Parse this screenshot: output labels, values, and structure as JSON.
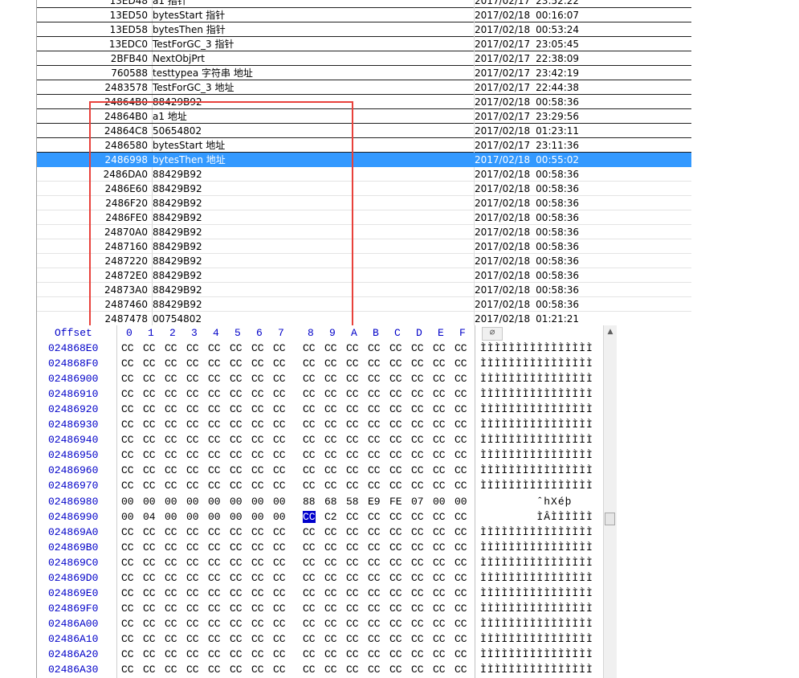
{
  "list": {
    "rows": [
      {
        "addr": "13ED48",
        "name": "a1 指针",
        "date": "2017/02/17",
        "time": "23:52:22"
      },
      {
        "addr": "13ED50",
        "name": "bytesStart 指针",
        "date": "2017/02/18",
        "time": "00:16:07"
      },
      {
        "addr": "13ED58",
        "name": "bytesThen 指针",
        "date": "2017/02/18",
        "time": "00:53:24"
      },
      {
        "addr": "13EDC0",
        "name": "TestForGC_3  指针",
        "date": "2017/02/17",
        "time": "23:05:45"
      },
      {
        "addr": "2BFB40",
        "name": "NextObjPrt",
        "date": "2017/02/17",
        "time": "22:38:09"
      },
      {
        "addr": "760588",
        "name": "testtypea 字符串 地址",
        "date": "2017/02/17",
        "time": "23:42:19"
      },
      {
        "addr": "2483578",
        "name": "TestForGC_3 地址",
        "date": "2017/02/17",
        "time": "22:44:38"
      },
      {
        "addr": "24864B0",
        "name": "88429B92",
        "date": "2017/02/18",
        "time": "00:58:36"
      },
      {
        "addr": "24864B0",
        "name": "a1 地址",
        "date": "2017/02/17",
        "time": "23:29:56"
      },
      {
        "addr": "24864C8",
        "name": "50654802",
        "date": "2017/02/18",
        "time": "01:23:11"
      },
      {
        "addr": "2486580",
        "name": "bytesStart 地址",
        "date": "2017/02/17",
        "time": "23:11:36"
      },
      {
        "addr": "2486998",
        "name": "bytesThen 地址",
        "date": "2017/02/18",
        "time": "00:55:02",
        "selected": true
      },
      {
        "addr": "2486DA0",
        "name": "88429B92",
        "date": "2017/02/18",
        "time": "00:58:36"
      },
      {
        "addr": "2486E60",
        "name": "88429B92",
        "date": "2017/02/18",
        "time": "00:58:36"
      },
      {
        "addr": "2486F20",
        "name": "88429B92",
        "date": "2017/02/18",
        "time": "00:58:36"
      },
      {
        "addr": "2486FE0",
        "name": "88429B92",
        "date": "2017/02/18",
        "time": "00:58:36"
      },
      {
        "addr": "24870A0",
        "name": "88429B92",
        "date": "2017/02/18",
        "time": "00:58:36"
      },
      {
        "addr": "2487160",
        "name": "88429B92",
        "date": "2017/02/18",
        "time": "00:58:36"
      },
      {
        "addr": "2487220",
        "name": "88429B92",
        "date": "2017/02/18",
        "time": "00:58:36"
      },
      {
        "addr": "24872E0",
        "name": "88429B92",
        "date": "2017/02/18",
        "time": "00:58:36"
      },
      {
        "addr": "24873A0",
        "name": "88429B92",
        "date": "2017/02/18",
        "time": "00:58:36"
      },
      {
        "addr": "2487460",
        "name": "88429B92",
        "date": "2017/02/18",
        "time": "00:58:36"
      },
      {
        "addr": "2487478",
        "name": "00754802",
        "date": "2017/02/18",
        "time": "01:21:21"
      }
    ]
  },
  "hex": {
    "header_label": "Offset",
    "columns": [
      "0",
      "1",
      "2",
      "3",
      "4",
      "5",
      "6",
      "7",
      "8",
      "9",
      "A",
      "B",
      "C",
      "D",
      "E",
      "F"
    ],
    "attach_icon": "paperclip-icon",
    "rows": [
      {
        "offset": "024868E0",
        "bytes": [
          "CC",
          "CC",
          "CC",
          "CC",
          "CC",
          "CC",
          "CC",
          "CC",
          "CC",
          "CC",
          "CC",
          "CC",
          "CC",
          "CC",
          "CC",
          "CC"
        ],
        "ascii": "ÌÌÌÌÌÌÌÌÌÌÌÌÌÌÌÌ"
      },
      {
        "offset": "024868F0",
        "bytes": [
          "CC",
          "CC",
          "CC",
          "CC",
          "CC",
          "CC",
          "CC",
          "CC",
          "CC",
          "CC",
          "CC",
          "CC",
          "CC",
          "CC",
          "CC",
          "CC"
        ],
        "ascii": "ÌÌÌÌÌÌÌÌÌÌÌÌÌÌÌÌ"
      },
      {
        "offset": "02486900",
        "bytes": [
          "CC",
          "CC",
          "CC",
          "CC",
          "CC",
          "CC",
          "CC",
          "CC",
          "CC",
          "CC",
          "CC",
          "CC",
          "CC",
          "CC",
          "CC",
          "CC"
        ],
        "ascii": "ÌÌÌÌÌÌÌÌÌÌÌÌÌÌÌÌ"
      },
      {
        "offset": "02486910",
        "bytes": [
          "CC",
          "CC",
          "CC",
          "CC",
          "CC",
          "CC",
          "CC",
          "CC",
          "CC",
          "CC",
          "CC",
          "CC",
          "CC",
          "CC",
          "CC",
          "CC"
        ],
        "ascii": "ÌÌÌÌÌÌÌÌÌÌÌÌÌÌÌÌ"
      },
      {
        "offset": "02486920",
        "bytes": [
          "CC",
          "CC",
          "CC",
          "CC",
          "CC",
          "CC",
          "CC",
          "CC",
          "CC",
          "CC",
          "CC",
          "CC",
          "CC",
          "CC",
          "CC",
          "CC"
        ],
        "ascii": "ÌÌÌÌÌÌÌÌÌÌÌÌÌÌÌÌ"
      },
      {
        "offset": "02486930",
        "bytes": [
          "CC",
          "CC",
          "CC",
          "CC",
          "CC",
          "CC",
          "CC",
          "CC",
          "CC",
          "CC",
          "CC",
          "CC",
          "CC",
          "CC",
          "CC",
          "CC"
        ],
        "ascii": "ÌÌÌÌÌÌÌÌÌÌÌÌÌÌÌÌ"
      },
      {
        "offset": "02486940",
        "bytes": [
          "CC",
          "CC",
          "CC",
          "CC",
          "CC",
          "CC",
          "CC",
          "CC",
          "CC",
          "CC",
          "CC",
          "CC",
          "CC",
          "CC",
          "CC",
          "CC"
        ],
        "ascii": "ÌÌÌÌÌÌÌÌÌÌÌÌÌÌÌÌ"
      },
      {
        "offset": "02486950",
        "bytes": [
          "CC",
          "CC",
          "CC",
          "CC",
          "CC",
          "CC",
          "CC",
          "CC",
          "CC",
          "CC",
          "CC",
          "CC",
          "CC",
          "CC",
          "CC",
          "CC"
        ],
        "ascii": "ÌÌÌÌÌÌÌÌÌÌÌÌÌÌÌÌ"
      },
      {
        "offset": "02486960",
        "bytes": [
          "CC",
          "CC",
          "CC",
          "CC",
          "CC",
          "CC",
          "CC",
          "CC",
          "CC",
          "CC",
          "CC",
          "CC",
          "CC",
          "CC",
          "CC",
          "CC"
        ],
        "ascii": "ÌÌÌÌÌÌÌÌÌÌÌÌÌÌÌÌ"
      },
      {
        "offset": "02486970",
        "bytes": [
          "CC",
          "CC",
          "CC",
          "CC",
          "CC",
          "CC",
          "CC",
          "CC",
          "CC",
          "CC",
          "CC",
          "CC",
          "CC",
          "CC",
          "CC",
          "CC"
        ],
        "ascii": "ÌÌÌÌÌÌÌÌÌÌÌÌÌÌÌÌ"
      },
      {
        "offset": "02486980",
        "bytes": [
          "00",
          "00",
          "00",
          "00",
          "00",
          "00",
          "00",
          "00",
          "88",
          "68",
          "58",
          "E9",
          "FE",
          "07",
          "00",
          "00"
        ],
        "ascii": "        ˆhXéþ  "
      },
      {
        "offset": "02486990",
        "bytes": [
          "00",
          "04",
          "00",
          "00",
          "00",
          "00",
          "00",
          "00",
          "CC",
          "C2",
          "CC",
          "CC",
          "CC",
          "CC",
          "CC",
          "CC"
        ],
        "ascii": "        ÌÂÌÌÌÌÌÌ"
      },
      {
        "offset": "024869A0",
        "bytes": [
          "CC",
          "CC",
          "CC",
          "CC",
          "CC",
          "CC",
          "CC",
          "CC",
          "CC",
          "CC",
          "CC",
          "CC",
          "CC",
          "CC",
          "CC",
          "CC"
        ],
        "ascii": "ÌÌÌÌÌÌÌÌÌÌÌÌÌÌÌÌ"
      },
      {
        "offset": "024869B0",
        "bytes": [
          "CC",
          "CC",
          "CC",
          "CC",
          "CC",
          "CC",
          "CC",
          "CC",
          "CC",
          "CC",
          "CC",
          "CC",
          "CC",
          "CC",
          "CC",
          "CC"
        ],
        "ascii": "ÌÌÌÌÌÌÌÌÌÌÌÌÌÌÌÌ"
      },
      {
        "offset": "024869C0",
        "bytes": [
          "CC",
          "CC",
          "CC",
          "CC",
          "CC",
          "CC",
          "CC",
          "CC",
          "CC",
          "CC",
          "CC",
          "CC",
          "CC",
          "CC",
          "CC",
          "CC"
        ],
        "ascii": "ÌÌÌÌÌÌÌÌÌÌÌÌÌÌÌÌ"
      },
      {
        "offset": "024869D0",
        "bytes": [
          "CC",
          "CC",
          "CC",
          "CC",
          "CC",
          "CC",
          "CC",
          "CC",
          "CC",
          "CC",
          "CC",
          "CC",
          "CC",
          "CC",
          "CC",
          "CC"
        ],
        "ascii": "ÌÌÌÌÌÌÌÌÌÌÌÌÌÌÌÌ"
      },
      {
        "offset": "024869E0",
        "bytes": [
          "CC",
          "CC",
          "CC",
          "CC",
          "CC",
          "CC",
          "CC",
          "CC",
          "CC",
          "CC",
          "CC",
          "CC",
          "CC",
          "CC",
          "CC",
          "CC"
        ],
        "ascii": "ÌÌÌÌÌÌÌÌÌÌÌÌÌÌÌÌ"
      },
      {
        "offset": "024869F0",
        "bytes": [
          "CC",
          "CC",
          "CC",
          "CC",
          "CC",
          "CC",
          "CC",
          "CC",
          "CC",
          "CC",
          "CC",
          "CC",
          "CC",
          "CC",
          "CC",
          "CC"
        ],
        "ascii": "ÌÌÌÌÌÌÌÌÌÌÌÌÌÌÌÌ"
      },
      {
        "offset": "02486A00",
        "bytes": [
          "CC",
          "CC",
          "CC",
          "CC",
          "CC",
          "CC",
          "CC",
          "CC",
          "CC",
          "CC",
          "CC",
          "CC",
          "CC",
          "CC",
          "CC",
          "CC"
        ],
        "ascii": "ÌÌÌÌÌÌÌÌÌÌÌÌÌÌÌÌ"
      },
      {
        "offset": "02486A10",
        "bytes": [
          "CC",
          "CC",
          "CC",
          "CC",
          "CC",
          "CC",
          "CC",
          "CC",
          "CC",
          "CC",
          "CC",
          "CC",
          "CC",
          "CC",
          "CC",
          "CC"
        ],
        "ascii": "ÌÌÌÌÌÌÌÌÌÌÌÌÌÌÌÌ"
      },
      {
        "offset": "02486A20",
        "bytes": [
          "CC",
          "CC",
          "CC",
          "CC",
          "CC",
          "CC",
          "CC",
          "CC",
          "CC",
          "CC",
          "CC",
          "CC",
          "CC",
          "CC",
          "CC",
          "CC"
        ],
        "ascii": "ÌÌÌÌÌÌÌÌÌÌÌÌÌÌÌÌ"
      },
      {
        "offset": "02486A30",
        "bytes": [
          "CC",
          "CC",
          "CC",
          "CC",
          "CC",
          "CC",
          "CC",
          "CC",
          "CC",
          "CC",
          "CC",
          "CC",
          "CC",
          "CC",
          "CC",
          "CC"
        ],
        "ascii": "ÌÌÌÌÌÌÌÌÌÌÌÌÌÌÌÌ"
      }
    ]
  },
  "colors": {
    "selection": "#3399ff",
    "annotation_box": "#e8413b",
    "hex_offset": "#0000c8"
  }
}
